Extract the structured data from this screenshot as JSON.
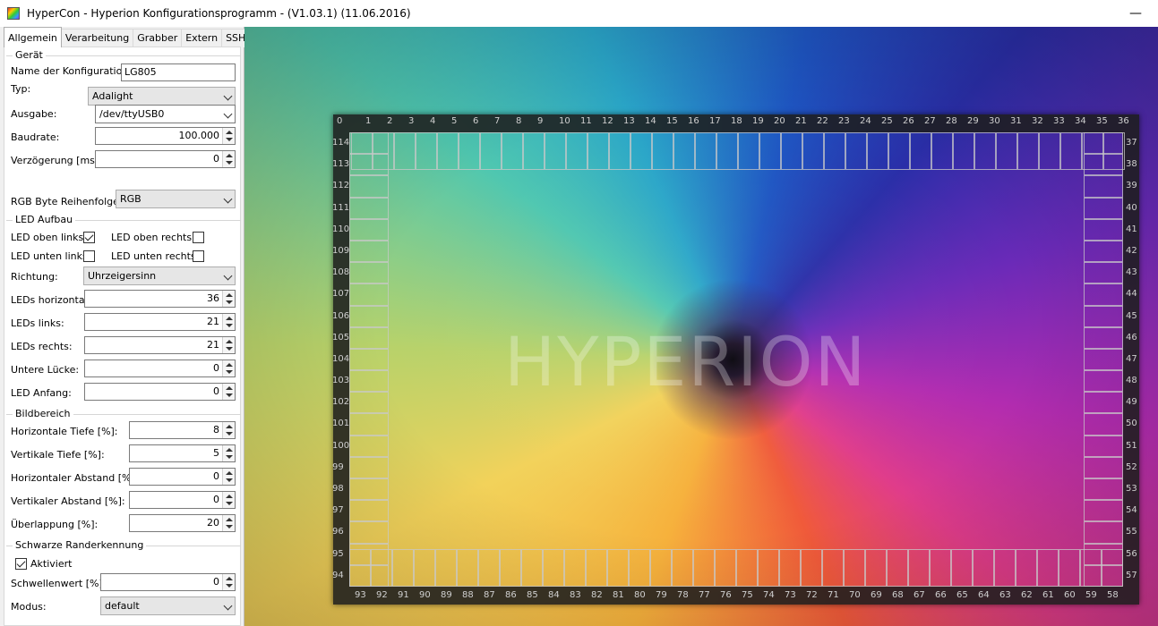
{
  "window": {
    "title": "HyperCon - Hyperion Konfigurationsprogramm - (V1.03.1) (11.06.2016)"
  },
  "tabs": [
    "Allgemein",
    "Verarbeitung",
    "Grabber",
    "Extern",
    "SSH"
  ],
  "geraet": {
    "group_label": "Gerät",
    "name_label": "Name der Konfiguration:",
    "name_value": "LG805",
    "typ_label": "Typ:",
    "typ_value": "Adalight",
    "ausgabe_label": "Ausgabe:",
    "ausgabe_value": "/dev/ttyUSB0",
    "baudrate_label": "Baudrate:",
    "baudrate_value": "100.000",
    "delay_label": "Verzögerung [ms]:",
    "delay_value": "0",
    "rgb_label": "RGB Byte Reihenfolge:",
    "rgb_value": "RGB"
  },
  "led_aufbau": {
    "group_label": "LED Aufbau",
    "top_left_label": "LED oben links:",
    "top_left_checked": true,
    "top_right_label": "LED oben rechts:",
    "top_right_checked": false,
    "bottom_left_label": "LED unten links:",
    "bottom_left_checked": false,
    "bottom_right_label": "LED unten rechts:",
    "bottom_right_checked": false,
    "richtung_label": "Richtung:",
    "richtung_value": "Uhrzeigersinn",
    "horizontal_label": "LEDs horizontal:",
    "horizontal_value": "36",
    "links_label": "LEDs links:",
    "links_value": "21",
    "rechts_label": "LEDs rechts:",
    "rechts_value": "21",
    "luecke_label": "Untere Lücke:",
    "luecke_value": "0",
    "anfang_label": "LED Anfang:",
    "anfang_value": "0"
  },
  "bildbereich": {
    "group_label": "Bildbereich",
    "h_tiefe_label": "Horizontale Tiefe [%]:",
    "h_tiefe_value": "8",
    "v_tiefe_label": "Vertikale Tiefe [%]:",
    "v_tiefe_value": "5",
    "h_abstand_label": "Horizontaler Abstand [%]:",
    "h_abstand_value": "0",
    "v_abstand_label": "Vertikaler Abstand [%]:",
    "v_abstand_value": "0",
    "ueberlappung_label": "Überlappung [%]:",
    "ueberlappung_value": "20"
  },
  "schwarz": {
    "group_label": "Schwarze Randerkennung",
    "aktiviert_label": "Aktiviert",
    "aktiviert_checked": true,
    "schwelle_label": "Schwellenwert [%]:",
    "schwelle_value": "0",
    "modus_label": "Modus:",
    "modus_value": "default"
  },
  "preview": {
    "watermark": "HYPERION",
    "top_numbers": [
      "0",
      "1",
      "2",
      "3",
      "4",
      "5",
      "6",
      "7",
      "8",
      "9",
      "10",
      "11",
      "12",
      "13",
      "14",
      "15",
      "16",
      "17",
      "18",
      "19",
      "20",
      "21",
      "22",
      "23",
      "24",
      "25",
      "26",
      "27",
      "28",
      "29",
      "30",
      "31",
      "32",
      "33",
      "34",
      "35",
      "36"
    ],
    "right_numbers": [
      "37",
      "38",
      "39",
      "40",
      "41",
      "42",
      "43",
      "44",
      "45",
      "46",
      "47",
      "48",
      "49",
      "50",
      "51",
      "52",
      "53",
      "54",
      "55",
      "56",
      "57"
    ],
    "bottom_numbers": [
      "93",
      "92",
      "91",
      "90",
      "89",
      "88",
      "87",
      "86",
      "85",
      "84",
      "83",
      "82",
      "81",
      "80",
      "79",
      "78",
      "77",
      "76",
      "75",
      "74",
      "73",
      "72",
      "71",
      "70",
      "69",
      "68",
      "67",
      "66",
      "65",
      "64",
      "63",
      "62",
      "61",
      "60",
      "59",
      "58"
    ],
    "left_numbers": [
      "114",
      "113",
      "112",
      "111",
      "110",
      "109",
      "108",
      "107",
      "106",
      "105",
      "104",
      "103",
      "102",
      "101",
      "100",
      "99",
      "98",
      "97",
      "96",
      "95",
      "94"
    ]
  },
  "colors": {
    "accent": "#0078d7",
    "frame": "#1e1e1e"
  }
}
